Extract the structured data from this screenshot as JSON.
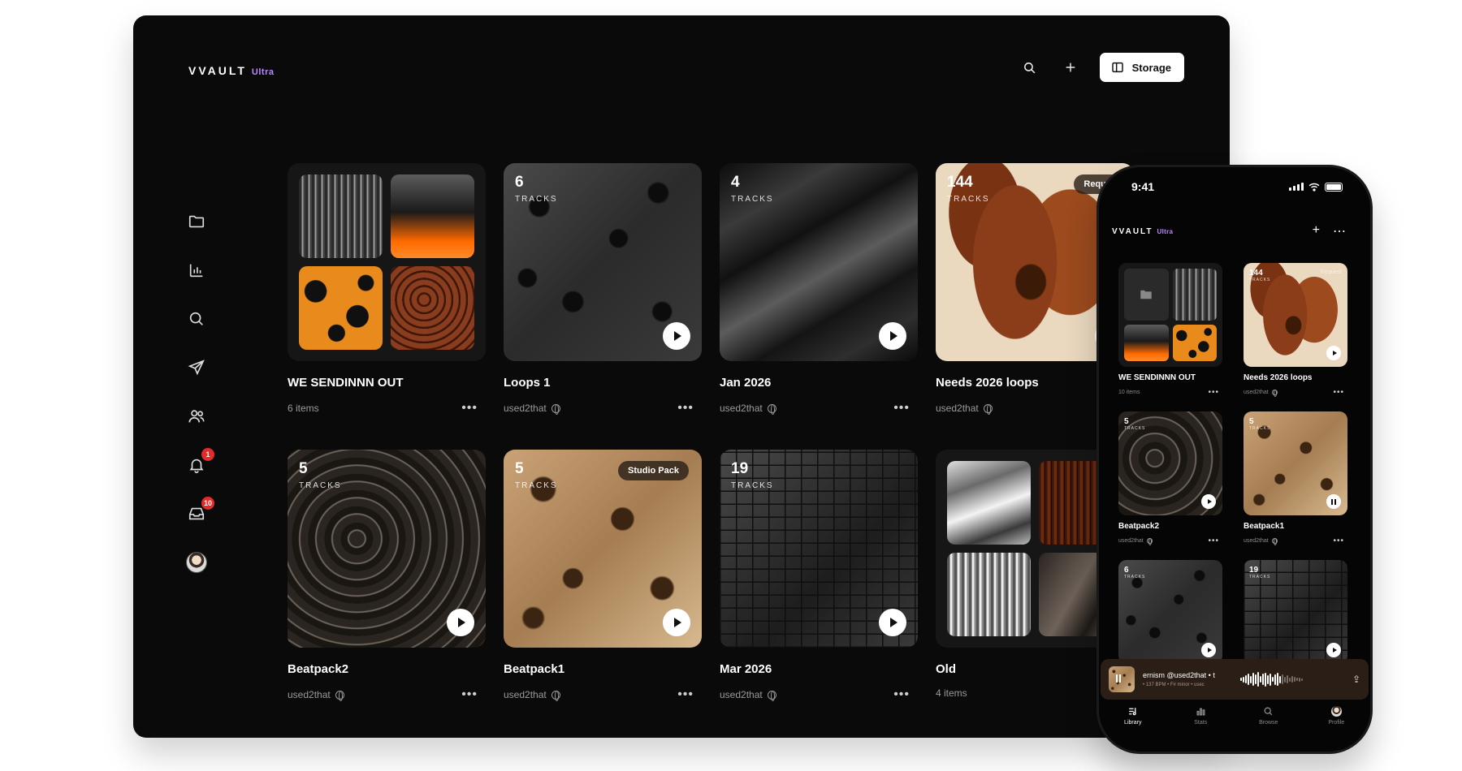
{
  "app": {
    "brand": "VVAULT",
    "tier": "Ultra"
  },
  "topbar": {
    "storage_label": "Storage"
  },
  "sidebar": {
    "items": [
      {
        "name": "library",
        "icon": "folder-icon"
      },
      {
        "name": "stats",
        "icon": "bar-chart-icon"
      },
      {
        "name": "search",
        "icon": "search-icon"
      },
      {
        "name": "send",
        "icon": "send-icon"
      },
      {
        "name": "contacts",
        "icon": "users-icon"
      },
      {
        "name": "notifications",
        "icon": "bell-icon",
        "badge": "1"
      },
      {
        "name": "inbox",
        "icon": "inbox-icon",
        "badge": "10"
      },
      {
        "name": "profile",
        "icon": "avatar"
      }
    ]
  },
  "cards": [
    {
      "title": "WE SENDINNN OUT",
      "subtitle": "6 items",
      "type": "folder"
    },
    {
      "title": "Loops 1",
      "owner": "used2that",
      "count": "6",
      "count_label": "TRACKS"
    },
    {
      "title": "Jan 2026",
      "owner": "used2that",
      "count": "4",
      "count_label": "TRACKS"
    },
    {
      "title": "Needs 2026 loops",
      "owner": "used2that",
      "count": "144",
      "count_label": "TRACKS",
      "pill": "Reque"
    },
    {
      "title": "Beatpack2",
      "owner": "used2that",
      "count": "5",
      "count_label": "TRACKS"
    },
    {
      "title": "Beatpack1",
      "owner": "used2that",
      "count": "5",
      "count_label": "TRACKS",
      "pill": "Studio Pack"
    },
    {
      "title": "Mar 2026",
      "owner": "used2that",
      "count": "19",
      "count_label": "TRACKS"
    },
    {
      "title": "Old",
      "subtitle": "4 items",
      "type": "folder"
    }
  ],
  "phone": {
    "time": "9:41",
    "brand": "VVAULT",
    "tier": "Ultra",
    "cards": [
      {
        "title": "WE SENDINNN OUT",
        "subtitle": "10 items"
      },
      {
        "title": "Needs 2026 loops",
        "owner": "used2that",
        "count": "144",
        "count_label": "TRACKS",
        "pill": "Request"
      },
      {
        "title": "Beatpack2",
        "owner": "used2that",
        "count": "5",
        "count_label": "TRACKS"
      },
      {
        "title": "Beatpack1",
        "owner": "used2that",
        "count": "5",
        "count_label": "TRACKS"
      },
      {
        "title": "",
        "count": "6",
        "count_label": "TRACKS"
      },
      {
        "title": "",
        "count": "19",
        "count_label": "TRACKS"
      }
    ],
    "player": {
      "title": "ernism @used2that • t",
      "meta": "• 137 BPM • F# minor • usec"
    },
    "tabs": [
      {
        "label": "Library",
        "icon": "library-icon",
        "active": true
      },
      {
        "label": "Stats",
        "icon": "stats-icon"
      },
      {
        "label": "Browse",
        "icon": "search-icon"
      },
      {
        "label": "Profile",
        "icon": "avatar"
      }
    ]
  },
  "colors": {
    "background": "#0a0a0a",
    "accent": "#b98aff",
    "badge": "#e32b2b"
  }
}
